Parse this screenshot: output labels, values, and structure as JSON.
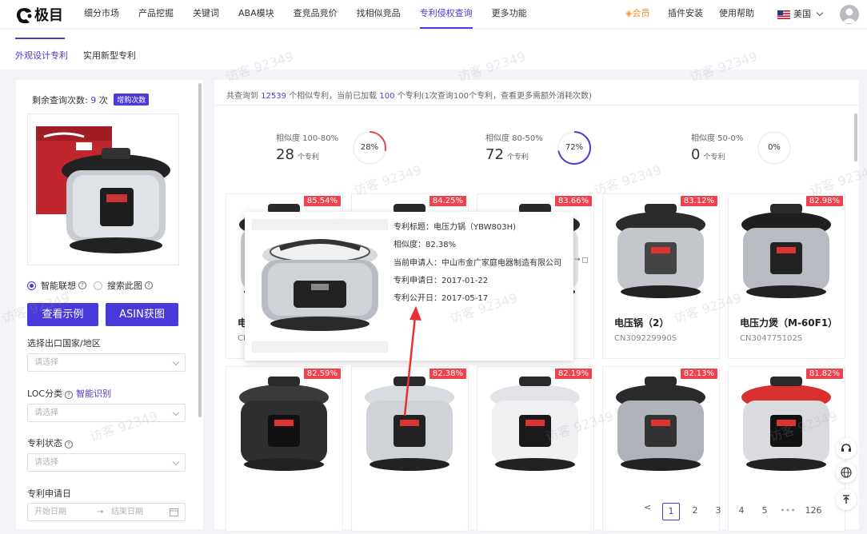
{
  "logo": {
    "text": "极目"
  },
  "nav": [
    "细分市场",
    "产品挖掘",
    "关键词",
    "ABA模块",
    "查竞品竞价",
    "找相似竞品",
    "专利侵权查询",
    "更多功能"
  ],
  "nav_active": 6,
  "header_right": {
    "vip": "会员",
    "plugin": "插件安装",
    "help": "使用帮助",
    "region": "美国"
  },
  "subtabs": [
    "外观设计专利",
    "实用新型专利"
  ],
  "credits": {
    "label": "剩余查询次数:",
    "count": "9",
    "unit": "次",
    "buy": "增购次数"
  },
  "radios": {
    "smart": "智能联想",
    "search": "搜索此图"
  },
  "buttons": {
    "example": "查看示例",
    "asin": "ASIN获图"
  },
  "filters": {
    "country": {
      "label": "选择出口国家/地区",
      "placeholder": "请选择"
    },
    "loc": {
      "label": "LOC分类",
      "link": "智能识别",
      "placeholder": "请选择"
    },
    "status": {
      "label": "专利状态",
      "placeholder": "请选择"
    },
    "date": {
      "label": "专利申请日",
      "start": "开始日期",
      "end": "结束日期"
    }
  },
  "summary": {
    "pre": "共查询到",
    "total": "12539",
    "mid": "个相似专利，当前已加载",
    "loaded": "100",
    "post": "个专利(1次查询100个专利，查看更多需额外消耗次数)"
  },
  "stats": [
    {
      "label": "相似度 100-80%",
      "count": "28",
      "unit": "个专利",
      "percent": "28%",
      "fraction": 0.28
    },
    {
      "label": "相似度 80-50%",
      "count": "72",
      "unit": "个专利",
      "percent": "72%",
      "fraction": 0.72
    },
    {
      "label": "相似度 50-0%",
      "count": "0",
      "unit": "个专利",
      "percent": "0%",
      "fraction": 0
    }
  ],
  "cards": [
    {
      "badge": "85.54%",
      "name": "电",
      "code": "CN"
    },
    {
      "badge": "84.25%",
      "name": "",
      "code": ""
    },
    {
      "badge": "83.66%",
      "name": "",
      "code": ""
    },
    {
      "badge": "83.12%",
      "name": "电压锅（2）",
      "code": "CN309229990S"
    },
    {
      "badge": "82.98%",
      "name": "电压力煲（M-60F1）",
      "code": "CN304775102S"
    },
    {
      "badge": "82.59%",
      "name": "",
      "code": ""
    },
    {
      "badge": "82.38%",
      "name": "",
      "code": ""
    },
    {
      "badge": "82.19%",
      "name": "",
      "code": ""
    },
    {
      "badge": "82.13%",
      "name": "",
      "code": ""
    },
    {
      "badge": "81.82%",
      "name": "",
      "code": ""
    }
  ],
  "tooltip": {
    "title": "专利标题：电压力锅（YBW803H)",
    "similarity": "相似度：82.38%",
    "applicant": "当前申请人：中山市金广家庭电器制造有限公司",
    "apply_date": "专利申请日：2017-01-22",
    "publish_date": "专利公开日：2017-05-17"
  },
  "pagination": {
    "pages": [
      "1",
      "2",
      "3",
      "4",
      "5"
    ],
    "ellipsis": "•••",
    "last": "126",
    "current": "1"
  },
  "watermark": "访客 92349",
  "colors": {
    "accent": "#4a3ad9",
    "badge": "#f0424c",
    "vip": "#f0932b"
  }
}
